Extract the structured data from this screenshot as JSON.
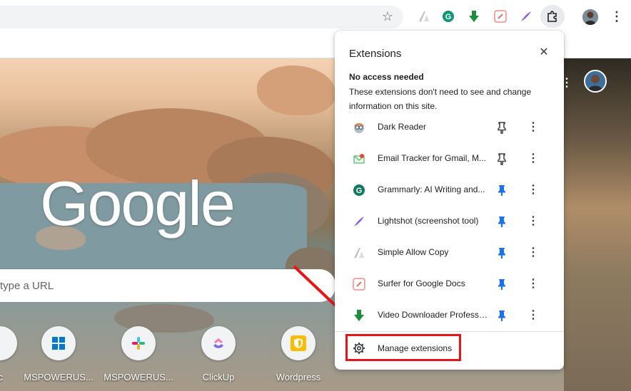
{
  "toolbar": {
    "icons": [
      "star-icon",
      "simple-allow-copy-icon",
      "grammarly-icon",
      "video-downloader-icon",
      "surfer-icon",
      "lightshot-icon",
      "extensions-puzzle-icon",
      "profile-avatar",
      "more-menu-icon"
    ]
  },
  "ntp": {
    "logo": "Google",
    "search_placeholder": "type a URL",
    "shortcuts": [
      {
        "label": "c",
        "icon": "partial-icon"
      },
      {
        "label": "MSPOWERUS...",
        "icon": "microsoft-store-icon"
      },
      {
        "label": "MSPOWERUS...",
        "icon": "slack-icon"
      },
      {
        "label": "ClickUp",
        "icon": "clickup-icon"
      },
      {
        "label": "Wordpress",
        "icon": "shield-icon"
      }
    ]
  },
  "popup": {
    "title": "Extensions",
    "section_title": "No access needed",
    "section_desc": "These extensions don't need to see and change information on this site.",
    "extensions": [
      {
        "name": "Dark Reader",
        "pinned": false
      },
      {
        "name": "Email Tracker for Gmail, M...",
        "pinned": false
      },
      {
        "name": "Grammarly: AI Writing and...",
        "pinned": true
      },
      {
        "name": "Lightshot (screenshot tool)",
        "pinned": true
      },
      {
        "name": "Simple Allow Copy",
        "pinned": true
      },
      {
        "name": "Surfer for Google Docs",
        "pinned": true
      },
      {
        "name": "Video Downloader Professi...",
        "pinned": true
      }
    ],
    "manage_label": "Manage extensions",
    "more_glyph": "⋮",
    "close_glyph": "✕"
  },
  "colors": {
    "pin_active": "#1a73e8",
    "pin_inactive": "#3c4043",
    "highlight": "#e8141a"
  }
}
